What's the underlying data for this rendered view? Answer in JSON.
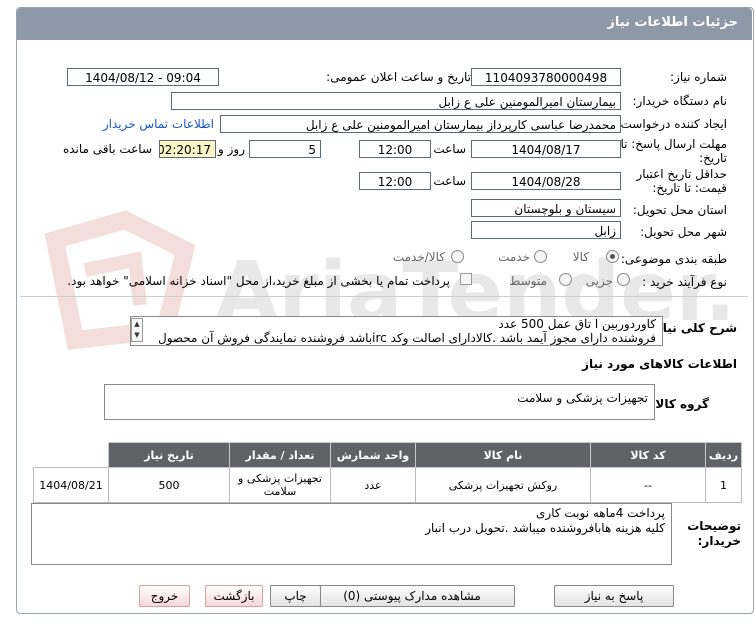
{
  "header": {
    "title": "جزئیات اطلاعات نیاز"
  },
  "fields": {
    "need_number_label": "شماره نیاز:",
    "need_number": "1104093780000498",
    "announce_label": "تاریخ و ساعت اعلان عمومی:",
    "announce_value": "1404/08/12 - 09:04",
    "buyer_label": "نام دستگاه خریدار:",
    "buyer": "بیمارستان امیرالمومنین علی  ع  زابل",
    "creator_label": "ایجاد کننده درخواست:",
    "creator": "محمدرضا عباسی کارپرداز بیمارستان امیرالمومنین علی  ع  زابل",
    "contact_link": "اطلاعات تماس خریدار",
    "deadline_label": "مهلت ارسال پاسخ: تا تاریخ:",
    "deadline_date": "1404/08/17",
    "hour_label": "ساعت",
    "deadline_time": "12:00",
    "days_value": "5",
    "days_label": "روز و",
    "remaining_time": "02:20:17",
    "remaining_label": "ساعت باقی مانده",
    "validity_label": "حداقل تاریخ اعتبار قیمت: تا تاریخ:",
    "validity_date": "1404/08/28",
    "validity_time": "12:00",
    "province_label": "استان محل تحویل:",
    "province": "سیستان و بلوچستان",
    "city_label": "شهر محل تحویل:",
    "city": "زابل",
    "category_label": "طبقه بندی موضوعی:",
    "category_options": [
      "کالا",
      "خدمت",
      "کالا/خدمت"
    ],
    "process_label": "نوع فرآیند خرید :",
    "process_options": [
      "جزیی",
      "متوسط"
    ],
    "payment_note": "پرداخت تمام یا بخشی از مبلغ خرید،از محل \"اسناد خزانه اسلامی\" خواهد بود."
  },
  "summary": {
    "label": "شرح کلی نیاز:",
    "text": "کاوردوربین ا تاق عمل  500 عدد\nفروشنده دارای مجوز آیمد باشد .کالادارای اصالت وکد ircباشد فروشنده نمایندگی فروش آن محصول راداشته"
  },
  "goods_info": {
    "title": "اطلاعات کالاهای مورد نیاز",
    "group_label": "گروه کالا:",
    "group_value": "تجهیزات پزشکی و سلامت"
  },
  "table": {
    "headers": [
      "ردیف",
      "کد کالا",
      "نام کالا",
      "واحد شمارش",
      "تعداد / مقدار",
      "تاریخ نیاز"
    ],
    "rows": [
      [
        "1",
        "--",
        "روکش تجهیزات پزشکی",
        "عدد",
        "500",
        "1404/08/21"
      ]
    ],
    "group_cell": "تجهیزات پزشکی و سلامت"
  },
  "buyer_notes": {
    "label": "توضیحات خریدار:",
    "text": "پرداخت 4ماهه نوبت کاری\nکلیه هزینه هابافروشنده میباشد .تحویل درب انبار"
  },
  "buttons": {
    "reply": "پاسخ به نیاز",
    "attachments": "مشاهده مدارک پیوستی (0)",
    "print": "چاپ",
    "back": "بازگشت",
    "exit": "خروج"
  },
  "watermark": {
    "text": "AriaTender.neT"
  },
  "colors": {
    "header": "#8d99a6",
    "table_header": "#5f6368",
    "link": "#1a57c6",
    "timer_bg": "#fbf5c6"
  }
}
